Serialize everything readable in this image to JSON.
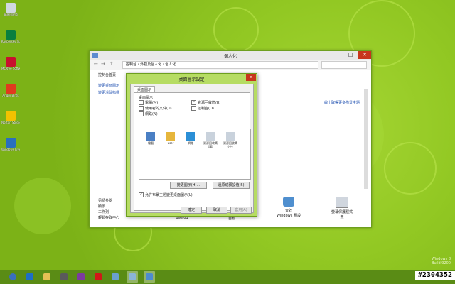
{
  "desktop": {
    "icons": [
      {
        "label": "資源回收筒",
        "icon": "recycle-bin-icon",
        "color": "#d0d8e0"
      },
      {
        "label": "Kaspersky Support",
        "icon": "kaspersky-icon",
        "color": "#0a7f3f"
      },
      {
        "label": "McAfee Software",
        "icon": "mcafee-icon",
        "color": "#c8102e"
      },
      {
        "label": "Angry Birds",
        "icon": "game-icon",
        "color": "#e03a1e"
      },
      {
        "label": "Norton Studio",
        "icon": "norton-icon",
        "color": "#f2c200"
      },
      {
        "label": "Windows Live Mesh",
        "icon": "windows-live-icon",
        "color": "#2a6fbe"
      }
    ]
  },
  "window": {
    "title": "個人化",
    "address": "控制台 › 外觀及個人化 › 個人化",
    "left_nav": [
      "控制台首頁",
      "變更桌面圖示",
      "變更滑鼠指標",
      "變更您的帳戶圖片"
    ],
    "see_also_title": "另請參閱",
    "see_also": [
      "顯示",
      "工作列",
      "輕鬆存取中心"
    ],
    "main_link": "線上取得更多佈景主題",
    "bottom_items": [
      {
        "label": "user01",
        "icon": "desktop-background-icon"
      },
      {
        "label": "自動",
        "icon": "color-icon"
      },
      {
        "label": "音效\nWindows 預設",
        "icon": "sounds-icon"
      },
      {
        "label": "螢幕保護程式\n無",
        "icon": "screensaver-icon"
      }
    ]
  },
  "dialog": {
    "title": "桌面圖示設定",
    "tab": "桌面圖示",
    "group_label": "桌面圖示",
    "checkboxes": [
      {
        "label": "電腦(M)",
        "checked": false
      },
      {
        "label": "資源回收筒(R)",
        "checked": true
      },
      {
        "label": "使用者的文件(U)",
        "checked": false
      },
      {
        "label": "控制台(O)",
        "checked": false
      },
      {
        "label": "網路(N)",
        "checked": false
      }
    ],
    "icons": [
      {
        "label": "電腦",
        "icon": "computer-icon"
      },
      {
        "label": "user",
        "icon": "user-folder-icon"
      },
      {
        "label": "網路",
        "icon": "network-icon"
      },
      {
        "label": "資源回收筒(滿)",
        "icon": "recycle-full-icon"
      },
      {
        "label": "資源回收筒(空)",
        "icon": "recycle-empty-icon"
      }
    ],
    "change_icon": "變更圖示(H)...",
    "restore_default": "還原成預設值(S)",
    "allow_themes": "允許布景主題變更桌面圖示(L)",
    "ok": "確定",
    "cancel": "取消",
    "apply": "套用(A)"
  },
  "taskbar": {
    "items": [
      "start-button",
      "ie-icon",
      "file-explorer-icon",
      "app-icon",
      "movie-icon",
      "power-icon",
      "app-icon-2",
      "control-panel-icon",
      "display-icon"
    ]
  },
  "watermark": {
    "line1": "Windows 8",
    "line2": "Build 9200"
  },
  "stamp": "#2304352"
}
